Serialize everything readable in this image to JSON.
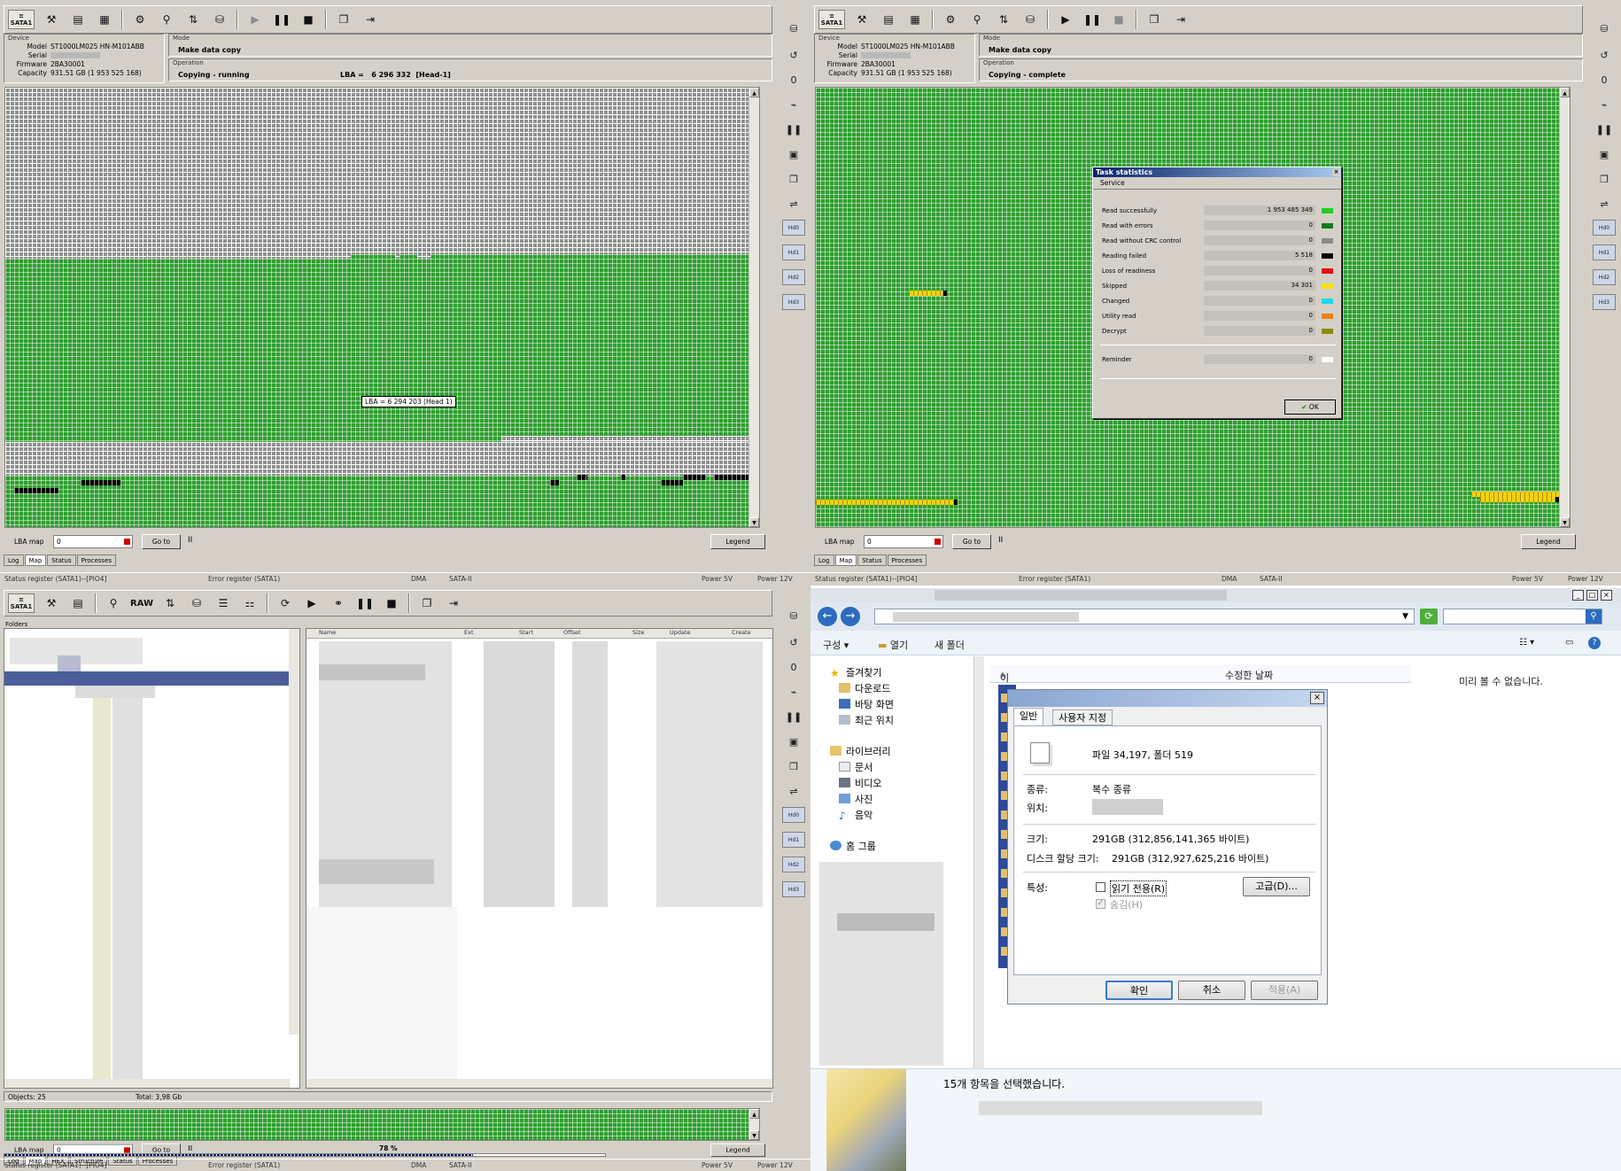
{
  "left_top": {
    "toolbar": {
      "sata_label": "SATA1"
    },
    "device": {
      "group_label": "Device",
      "model_key": "Model",
      "model": "ST1000LM025 HN-M101ABB",
      "serial_key": "Serial",
      "serial": "",
      "firmware_key": "Firmware",
      "firmware": "2BA30001",
      "capacity_key": "Capacity",
      "capacity": "931.51 GB (1 953 525 168)"
    },
    "mode_label": "Mode",
    "mode_value": "Make data copy",
    "operation_label": "Operation",
    "operation_value": "Copying - running",
    "lba_label": "LBA =",
    "lba_value": "6 296 332",
    "lba_head": "[Head-1]",
    "tooltip": "LBA = 6 294 203 (Head 1)",
    "lba_map_label": "LBA map",
    "lba_map_value": "0",
    "goto_label": "Go to",
    "pause_label": "II",
    "legend_label": "Legend",
    "tabs": [
      "Log",
      "Map",
      "Status",
      "Processes"
    ],
    "status": {
      "status_register": "Status register (SATA1)--[PIO4]",
      "error_register": "Error register (SATA1)",
      "dma": "DMA",
      "sata": "SATA-II",
      "power5": "Power 5V",
      "power12": "Power 12V"
    }
  },
  "right_top": {
    "toolbar": {
      "sata_label": "SATA1"
    },
    "device": {
      "group_label": "Device",
      "model_key": "Model",
      "model": "ST1000LM025 HN-M101ABB",
      "serial_key": "Serial",
      "serial": "",
      "firmware_key": "Firmware",
      "firmware": "2BA30001",
      "capacity_key": "Capacity",
      "capacity": "931.51 GB (1 953 525 168)"
    },
    "mode_label": "Mode",
    "mode_value": "Make data copy",
    "operation_label": "Operation",
    "operation_value": "Copying - complete",
    "task_statistics": {
      "title": "Task statistics",
      "service": "Service",
      "rows": [
        {
          "label": "Read successfully",
          "value": "1 953 485 349",
          "color": "#22d022"
        },
        {
          "label": "Read with errors",
          "value": "0",
          "color": "#0f7a1e"
        },
        {
          "label": "Read without CRC control",
          "value": "0",
          "color": "#8a8a8a"
        },
        {
          "label": "Reading failed",
          "value": "5 518",
          "color": "#000000"
        },
        {
          "label": "Loss of readiness",
          "value": "0",
          "color": "#e01010"
        },
        {
          "label": "Skipped",
          "value": "34 301",
          "color": "#f5e010"
        },
        {
          "label": "Changed",
          "value": "0",
          "color": "#20d8e8"
        },
        {
          "label": "Utility read",
          "value": "0",
          "color": "#f08010"
        },
        {
          "label": "Decrypt",
          "value": "0",
          "color": "#8a8a10"
        },
        {
          "label": "Reminder",
          "value": "0",
          "color": "#ffffff"
        }
      ],
      "ok_label": "OK"
    },
    "lba_map_label": "LBA map",
    "lba_map_value": "0",
    "goto_label": "Go to",
    "pause_label": "II",
    "legend_label": "Legend",
    "tabs": [
      "Log",
      "Map",
      "Status",
      "Processes"
    ],
    "status": {
      "status_register": "Status register (SATA1)--[PIO4]",
      "error_register": "Error register (SATA1)",
      "dma": "DMA",
      "sata": "SATA-II",
      "power5": "Power 5V",
      "power12": "Power 12V"
    }
  },
  "left_bottom": {
    "toolbar": {
      "sata_label": "SATA1",
      "raw_label": "RAW"
    },
    "folders_label": "Folders",
    "file_columns": [
      "Name",
      "Ext",
      "Start",
      "Offset",
      "Size",
      "Update",
      "Create"
    ],
    "objects": "Objects: 25",
    "total": "Total: 3,98 Gb",
    "lba_map_label": "LBA map",
    "lba_map_value": "0",
    "goto_label": "Go to",
    "pause_label": "II",
    "legend_label": "Legend",
    "tabs": [
      "Log",
      "Map",
      "HEX",
      "Structure",
      "Status",
      "Processes"
    ],
    "progress": 78,
    "progress_text": "78 %",
    "status": {
      "status_register": "Status register (SATA1)--[PIO4]",
      "error_register": "Error register (SATA1)",
      "dma": "DMA",
      "sata": "SATA-II",
      "power5": "Power 5V",
      "power12": "Power 12V"
    }
  },
  "right_bottom": {
    "commands": {
      "organize": "구성 ▾",
      "open": "열기",
      "new_folder": "새 폴더"
    },
    "tree": {
      "favorites": "즐겨찾기",
      "downloads": "다운로드",
      "desktop": "바탕 화면",
      "recent": "최근 위치",
      "libraries": "라이브러리",
      "documents": "문서",
      "videos": "비디오",
      "pictures": "사진",
      "music": "음악",
      "homegroup": "홈 그룹"
    },
    "columns": {
      "name": "이름",
      "modified": "수정한 날짜"
    },
    "preview": "미리 볼 수 없습니다.",
    "selection_status": "15개 항목을 선택했습니다.",
    "properties": {
      "tab_general": "일반",
      "tab_custom": "사용자 지정",
      "summary": "파일 34,197, 폴더 519",
      "type_label": "종류:",
      "type_value": "복수 종류",
      "location_label": "위치:",
      "size_label": "크기:",
      "size_value": "291GB (312,856,141,365 바이트)",
      "disk_size_label": "디스크 할당 크기:",
      "disk_size_value": "291GB (312,927,625,216 바이트)",
      "attributes_label": "특성:",
      "readonly_label": "읽기 전용(R)",
      "hidden_label": "숨김(H)",
      "advanced_label": "고급(D)...",
      "ok_label": "확인",
      "cancel_label": "취소",
      "apply_label": "적용(A)"
    }
  }
}
